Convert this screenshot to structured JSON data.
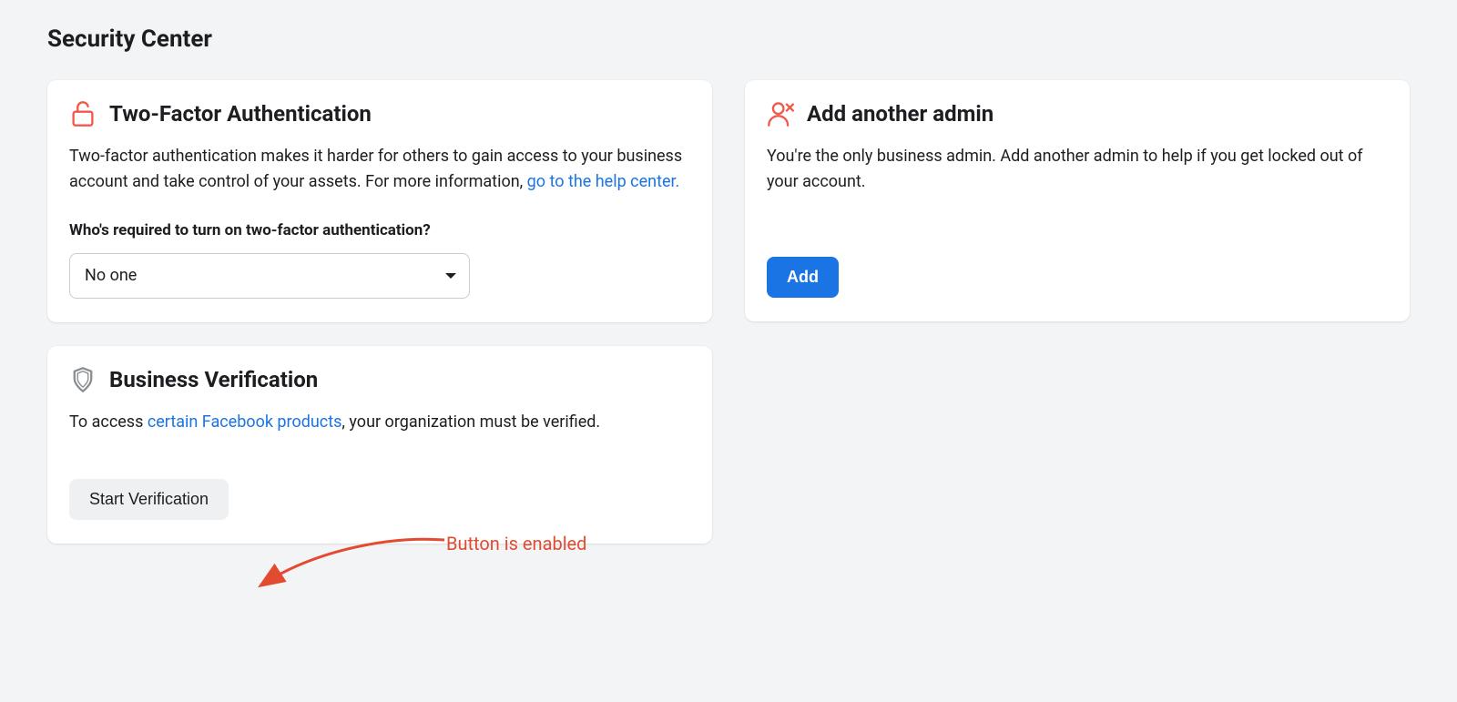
{
  "page": {
    "title": "Security Center"
  },
  "two_factor": {
    "title": "Two-Factor Authentication",
    "desc_pre": "Two-factor authentication makes it harder for others to gain access to your business account and take control of your assets. For more information, ",
    "help_link_text": "go to the help center.",
    "who_label": "Who's required to turn on two-factor authentication?",
    "select_value": "No one"
  },
  "business_verification": {
    "title": "Business Verification",
    "desc_pre": "To access ",
    "link_text": "certain Facebook products",
    "desc_post": ", your organization must be verified.",
    "button_label": "Start Verification"
  },
  "add_admin": {
    "title": "Add another admin",
    "desc": "You're the only business admin. Add another admin to help if you get locked out of your account.",
    "button_label": "Add"
  },
  "annotation": {
    "text": "Button is enabled",
    "color": "#e24b30"
  }
}
